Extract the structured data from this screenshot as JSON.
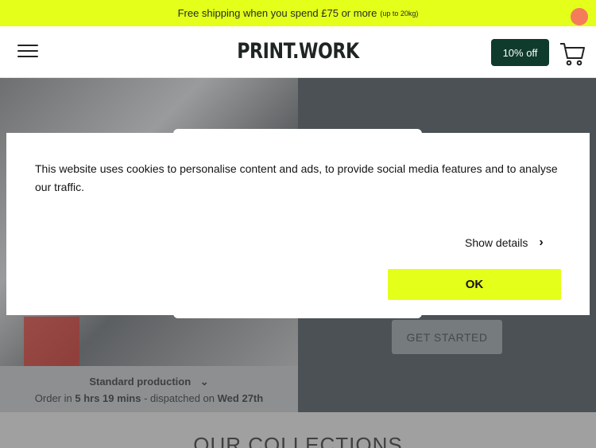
{
  "promo": {
    "text": "Free shipping when you spend £75 or more",
    "note": "(up to 20kg)"
  },
  "header": {
    "logo": "PRINT.WORK",
    "discount_label": "10% off",
    "icons": {
      "menu": "hamburger-menu-icon",
      "cart": "shopping-cart-icon"
    },
    "colors": {
      "accent": "#e4ff1a",
      "brand_dark": "#0f3b2c",
      "cart_badge": "#f47c5b"
    }
  },
  "hero": {
    "production_label": "Standard production",
    "order_prefix": "Order in",
    "order_time": "5 hrs 19 mins",
    "dispatch_text": "- dispatched on",
    "dispatch_date": "Wed 27th",
    "cta_label": "GET STARTED"
  },
  "collections": {
    "title": "OUR COLLECTIONS"
  },
  "cookie": {
    "message": "This website uses cookies to personalise content and ads, to provide social media features and to analyse our traffic.",
    "show_details_label": "Show details",
    "ok_label": "OK"
  }
}
